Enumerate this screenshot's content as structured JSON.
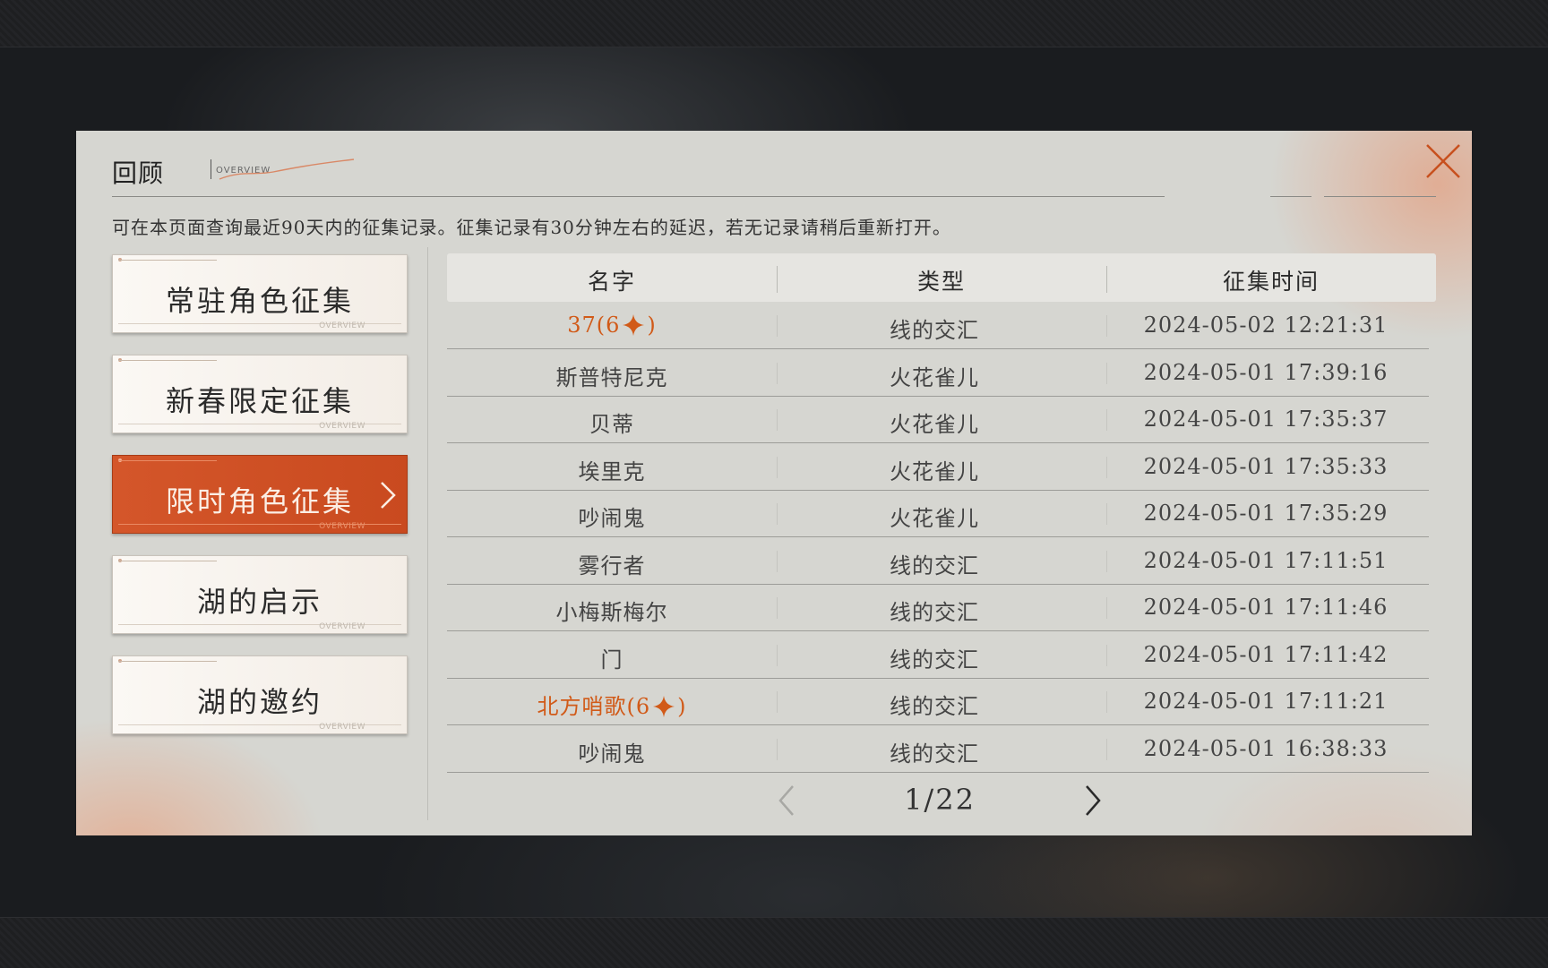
{
  "header": {
    "title": "回顾",
    "subtitle": "OVERVIEW",
    "notice": "可在本页面查询最近90天内的征集记录。征集记录有30分钟左右的延迟，若无记录请稍后重新打开。"
  },
  "categories": [
    {
      "label": "常驻角色征集",
      "tag": "OVERVIEW",
      "active": false
    },
    {
      "label": "新春限定征集",
      "tag": "OVERVIEW",
      "active": false
    },
    {
      "label": "限时角色征集",
      "tag": "OVERVIEW",
      "active": true
    },
    {
      "label": "湖的启示",
      "tag": "OVERVIEW",
      "active": false
    },
    {
      "label": "湖的邀约",
      "tag": "OVERVIEW",
      "active": false
    }
  ],
  "table": {
    "columns": [
      "名字",
      "类型",
      "征集时间"
    ],
    "rows": [
      {
        "name": "37(6",
        "name_suffix": ")",
        "rare": true,
        "type": "线的交汇",
        "time": "2024-05-02 12:21:31"
      },
      {
        "name": "斯普特尼克",
        "name_suffix": "",
        "rare": false,
        "type": "火花雀儿",
        "time": "2024-05-01 17:39:16"
      },
      {
        "name": "贝蒂",
        "name_suffix": "",
        "rare": false,
        "type": "火花雀儿",
        "time": "2024-05-01 17:35:37"
      },
      {
        "name": "埃里克",
        "name_suffix": "",
        "rare": false,
        "type": "火花雀儿",
        "time": "2024-05-01 17:35:33"
      },
      {
        "name": "吵闹鬼",
        "name_suffix": "",
        "rare": false,
        "type": "火花雀儿",
        "time": "2024-05-01 17:35:29"
      },
      {
        "name": "雾行者",
        "name_suffix": "",
        "rare": false,
        "type": "线的交汇",
        "time": "2024-05-01 17:11:51"
      },
      {
        "name": "小梅斯梅尔",
        "name_suffix": "",
        "rare": false,
        "type": "线的交汇",
        "time": "2024-05-01 17:11:46"
      },
      {
        "name": "门",
        "name_suffix": "",
        "rare": false,
        "type": "线的交汇",
        "time": "2024-05-01 17:11:42"
      },
      {
        "name": "北方哨歌(6",
        "name_suffix": ")",
        "rare": true,
        "type": "线的交汇",
        "time": "2024-05-01 17:11:21"
      },
      {
        "name": "吵闹鬼",
        "name_suffix": "",
        "rare": false,
        "type": "线的交汇",
        "time": "2024-05-01 16:38:33"
      }
    ]
  },
  "pager": {
    "label": "1/22",
    "current": 1,
    "total": 22
  },
  "colors": {
    "accent": "#d4562a",
    "rare_text": "#d15a18",
    "panel_bg": "#d6d6d1"
  },
  "icons": {
    "close": "close-icon",
    "star": "star-icon",
    "prev": "chevron-left-icon",
    "next": "chevron-right-icon",
    "active_marker": "chevron-right-icon"
  }
}
